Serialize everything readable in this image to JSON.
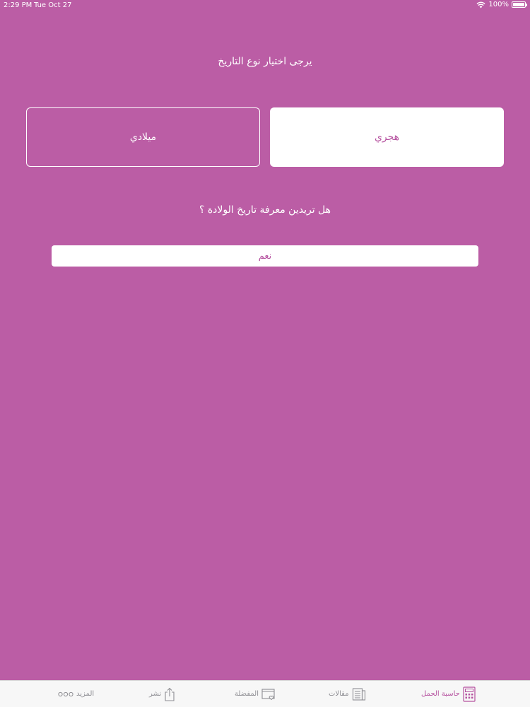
{
  "status_bar": {
    "time": "2:29 PM",
    "date": "Tue Oct 27",
    "battery": "100%"
  },
  "main": {
    "date_type_prompt": "يرجى اختيار نوع التاريخ",
    "gregorian_label": "ميلادي",
    "hijri_label": "هجري",
    "due_date_question": "هل تريدين معرفة تاريخ الولادة ؟",
    "yes_label": "نعم"
  },
  "tabbar": {
    "tabs": [
      {
        "label": "حاسبة الحمل",
        "icon": "calculator-icon",
        "active": true
      },
      {
        "label": "مقالات",
        "icon": "articles-icon",
        "active": false
      },
      {
        "label": "المفضلة",
        "icon": "favorites-icon",
        "active": false
      },
      {
        "label": "نشر",
        "icon": "share-icon",
        "active": false
      },
      {
        "label": "المزيد",
        "icon": "more-icon",
        "active": false
      }
    ]
  },
  "colors": {
    "background": "#bb5da5",
    "accent": "#b5519f",
    "tabbar": "#f7f7f7"
  }
}
